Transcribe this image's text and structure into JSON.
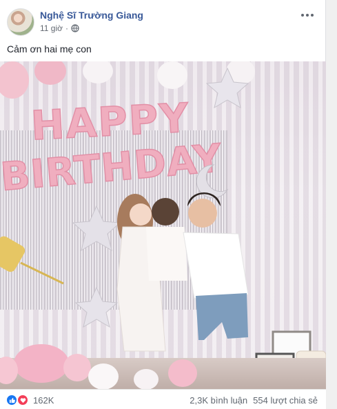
{
  "post": {
    "author": "Nghệ Sĩ Trường Giang",
    "time": "11 giờ",
    "privacy_icon": "globe-icon",
    "more_icon": "more-options-icon",
    "caption": "Cảm ơn hai mẹ con"
  },
  "photo": {
    "balloon_text_line1": "HAPPY",
    "balloon_text_line2": "BIRTHDAY"
  },
  "footer": {
    "reaction_icons": [
      "like-icon",
      "love-icon"
    ],
    "reaction_count": "162K",
    "comments": "2,3K bình luận",
    "shares": "554 lượt chia sẻ"
  },
  "colors": {
    "link": "#385898",
    "text": "#1d2129",
    "muted": "#616770",
    "like": "#1877f2",
    "love": "#f33e58",
    "balloon_pink": "#f2b7c6"
  }
}
